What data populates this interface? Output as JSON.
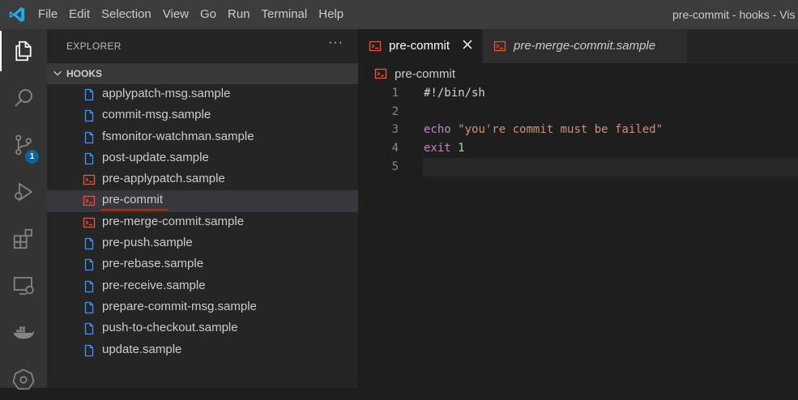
{
  "menu": [
    "File",
    "Edit",
    "Selection",
    "View",
    "Go",
    "Run",
    "Terminal",
    "Help"
  ],
  "window_title": "pre-commit - hooks - Vis",
  "activity": {
    "icons": [
      "files-icon",
      "search-icon",
      "source-control-icon",
      "run-debug-icon",
      "extensions-icon",
      "remote-explorer-icon",
      "docker-icon",
      "kubernetes-icon"
    ],
    "source_control_badge": "1"
  },
  "explorer": {
    "title": "EXPLORER",
    "more": "···",
    "section": "HOOKS",
    "files": [
      {
        "name": "applypatch-msg.sample",
        "type": "doc"
      },
      {
        "name": "commit-msg.sample",
        "type": "doc"
      },
      {
        "name": "fsmonitor-watchman.sample",
        "type": "doc"
      },
      {
        "name": "post-update.sample",
        "type": "doc"
      },
      {
        "name": "pre-applypatch.sample",
        "type": "shell"
      },
      {
        "name": "pre-commit",
        "type": "shell"
      },
      {
        "name": "pre-merge-commit.sample",
        "type": "shell"
      },
      {
        "name": "pre-push.sample",
        "type": "doc"
      },
      {
        "name": "pre-rebase.sample",
        "type": "doc"
      },
      {
        "name": "pre-receive.sample",
        "type": "doc"
      },
      {
        "name": "prepare-commit-msg.sample",
        "type": "doc"
      },
      {
        "name": "push-to-checkout.sample",
        "type": "doc"
      },
      {
        "name": "update.sample",
        "type": "doc"
      }
    ],
    "selected": "pre-commit"
  },
  "tabs": [
    {
      "label": "pre-commit",
      "active": true
    },
    {
      "label": "pre-merge-commit.sample",
      "active": false
    }
  ],
  "breadcrumb": "pre-commit",
  "editor": {
    "lines": [
      {
        "num": "1",
        "parts": [
          {
            "t": "#!/bin/sh",
            "c": "comment"
          }
        ]
      },
      {
        "num": "2",
        "parts": []
      },
      {
        "num": "3",
        "parts": [
          {
            "t": "echo ",
            "c": "kw"
          },
          {
            "t": "\"you're commit must be failed\"",
            "c": "str"
          }
        ]
      },
      {
        "num": "4",
        "parts": [
          {
            "t": "exit ",
            "c": "kw"
          },
          {
            "t": "1",
            "c": "num"
          }
        ]
      },
      {
        "num": "5",
        "parts": []
      }
    ],
    "current_line": "5"
  },
  "colors": {
    "shell_icon": "#f05033",
    "doc_icon": "#3794ff",
    "underline": "#e51400",
    "accent": "#0e639c"
  }
}
